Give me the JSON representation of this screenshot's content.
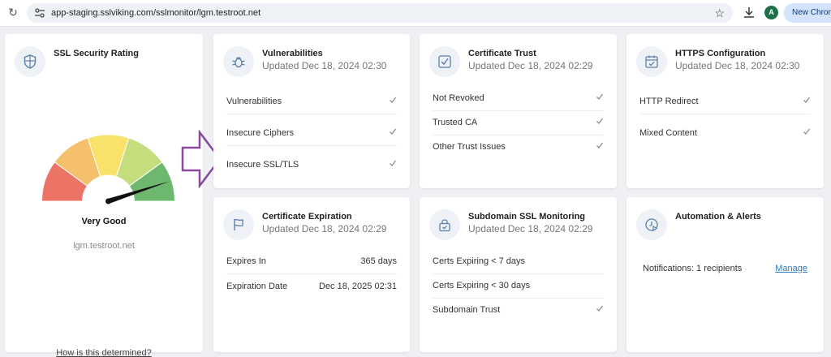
{
  "browser": {
    "url": "app-staging.sslviking.com/sslmonitor/lgm.testroot.net",
    "profile_initial": "A",
    "new_chrome_label": "New Chrome"
  },
  "ssl_rating": {
    "title": "SSL Security Rating",
    "rating": "Very Good",
    "rating_fraction": 0.9,
    "domain": "lgm.testroot.net",
    "how_link": "How is this determined?",
    "gauge_colors": [
      "#ec7466",
      "#f5c06b",
      "#f8e269",
      "#c4de7d",
      "#6db86e"
    ]
  },
  "vulnerabilities": {
    "title": "Vulnerabilities",
    "updated": "Updated Dec 18, 2024 02:30",
    "rows": [
      "Vulnerabilities",
      "Insecure Ciphers",
      "Insecure SSL/TLS"
    ]
  },
  "certificate_trust": {
    "title": "Certificate Trust",
    "updated": "Updated Dec 18, 2024 02:29",
    "rows": [
      "Not Revoked",
      "Trusted CA",
      "Other Trust Issues"
    ]
  },
  "https_config": {
    "title": "HTTPS Configuration",
    "updated": "Updated Dec 18, 2024 02:30",
    "rows": [
      "HTTP Redirect",
      "Mixed Content"
    ]
  },
  "cert_expiration": {
    "title": "Certificate Expiration",
    "updated": "Updated Dec 18, 2024 02:29",
    "expires_in_label": "Expires In",
    "expires_in_value": "365 days",
    "expiration_date_label": "Expiration Date",
    "expiration_date_value": "Dec 18, 2025 02:31"
  },
  "subdomain": {
    "title": "Subdomain SSL Monitoring",
    "updated": "Updated Dec 18, 2024 02:29",
    "rows": [
      "Certs Expiring < 7 days",
      "Certs Expiring < 30 days",
      "Subdomain Trust"
    ]
  },
  "automation": {
    "title": "Automation & Alerts",
    "notifications": "Notifications: 1 recipients",
    "manage": "Manage"
  },
  "colors": {
    "check": "#8a9099",
    "icon": "#5a7fa8",
    "arrow": "#8a4a9c",
    "link": "#2a7bbf"
  }
}
